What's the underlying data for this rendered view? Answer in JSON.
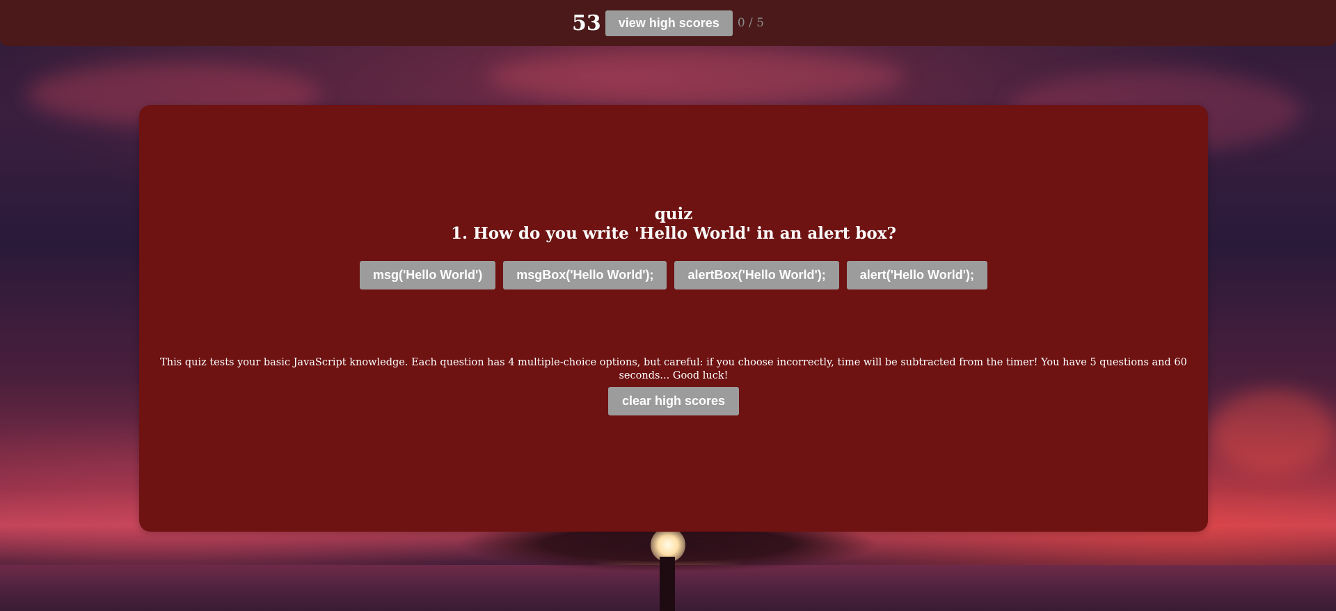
{
  "header": {
    "timer": "53",
    "view_high_scores_label": "view high scores",
    "progress": "0 / 5"
  },
  "quiz": {
    "title": "quiz",
    "question": "1. How do you write 'Hello World' in an alert box?",
    "answers": [
      {
        "label": "msg('Hello World')"
      },
      {
        "label": "msgBox('Hello World');"
      },
      {
        "label": "alertBox('Hello World');"
      },
      {
        "label": "alert('Hello World');"
      }
    ],
    "description": "This quiz tests your basic JavaScript knowledge. Each question has 4 multiple-choice options, but careful: if you choose incorrectly, time will be subtracted from the timer! You have 5 questions and 60 seconds... Good luck!",
    "clear_high_scores_label": "clear high scores"
  },
  "theme": {
    "topbar_color": "#4b1919",
    "card_color": "#6e1212",
    "button_color": "#9c9c9c",
    "progress_color": "#8e8e8e"
  },
  "background": {
    "image": "sunset-tree-over-sea"
  }
}
